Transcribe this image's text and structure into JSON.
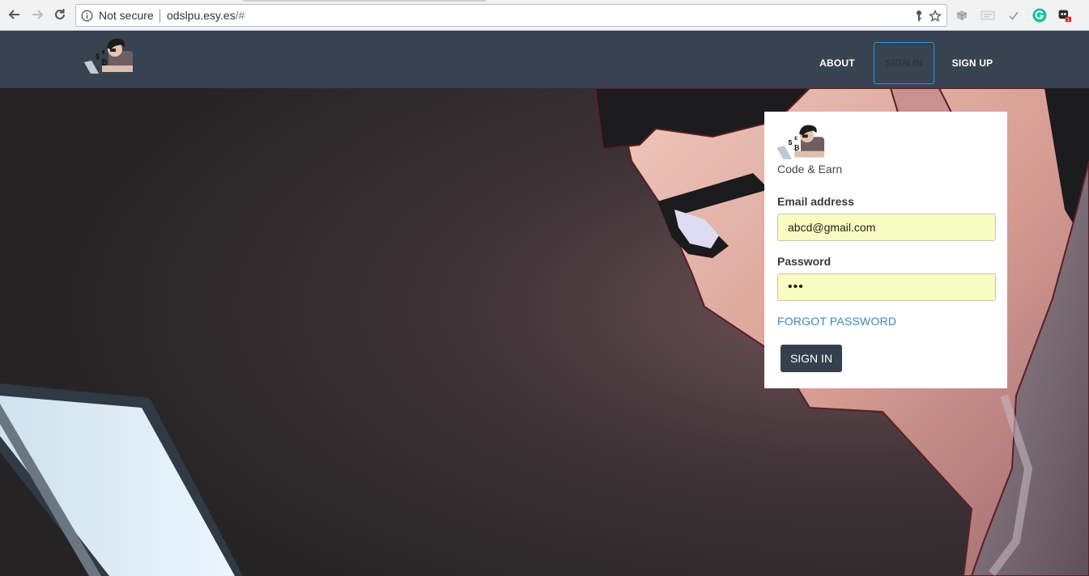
{
  "browser": {
    "security_label": "Not secure",
    "url_host": "odslpu.esy.es",
    "url_path": "/#",
    "extension_badge": "1"
  },
  "navbar": {
    "links": [
      {
        "label": "ABOUT"
      },
      {
        "label": "SIGN IN"
      },
      {
        "label": "SIGN UP"
      }
    ]
  },
  "login": {
    "tagline": "Code & Earn",
    "email_label": "Email address",
    "email_value": "abcd@gmail.com",
    "password_label": "Password",
    "password_value": "abc",
    "forgot_label": "FORGOT PASSWORD",
    "submit_label": "SIGN IN"
  },
  "colors": {
    "navbar_bg": "#374350",
    "active_border": "#1f9ad6",
    "link_blue": "#3d87c3",
    "autofill_bg": "#fafcc0"
  }
}
